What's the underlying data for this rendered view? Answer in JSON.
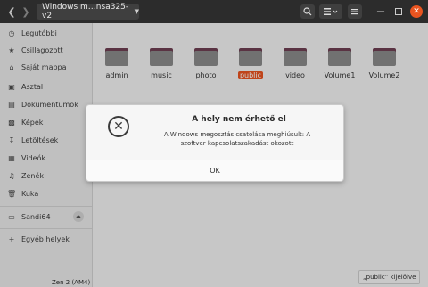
{
  "header": {
    "path": "Windows m…nsa325-v2",
    "back_icon": "chevron-left-icon",
    "forward_icon": "chevron-right-icon"
  },
  "sidebar": {
    "items": [
      {
        "icon": "clock-icon",
        "label": "Legutóbbi"
      },
      {
        "icon": "star-icon",
        "label": "Csillagozott"
      },
      {
        "icon": "home-icon",
        "label": "Saját mappa"
      },
      {
        "icon": "desktop-icon",
        "label": "Asztal"
      },
      {
        "icon": "document-icon",
        "label": "Dokumentumok"
      },
      {
        "icon": "image-icon",
        "label": "Képek"
      },
      {
        "icon": "download-icon",
        "label": "Letöltések"
      },
      {
        "icon": "video-icon",
        "label": "Videók"
      },
      {
        "icon": "music-icon",
        "label": "Zenék"
      },
      {
        "icon": "trash-icon",
        "label": "Kuka"
      }
    ],
    "drive": {
      "icon": "drive-icon",
      "label": "Sandi64"
    },
    "other": {
      "icon": "plus-icon",
      "label": "Egyéb helyek"
    }
  },
  "folders": [
    {
      "label": "admin",
      "selected": false
    },
    {
      "label": "music",
      "selected": false
    },
    {
      "label": "photo",
      "selected": false
    },
    {
      "label": "public",
      "selected": true
    },
    {
      "label": "video",
      "selected": false
    },
    {
      "label": "Volume1",
      "selected": false
    },
    {
      "label": "Volume2",
      "selected": false
    }
  ],
  "status": "„public” kijelölve",
  "below_text": "Zen 2  (AM4)",
  "dialog": {
    "title": "A hely nem érhető el",
    "message": "A Windows megosztás csatolása meghiúsult: A szoftver kapcsolatszakadást okozott",
    "ok_label": "OK"
  },
  "colors": {
    "accent": "#e95420",
    "folder_tab": "#6e3f52"
  }
}
